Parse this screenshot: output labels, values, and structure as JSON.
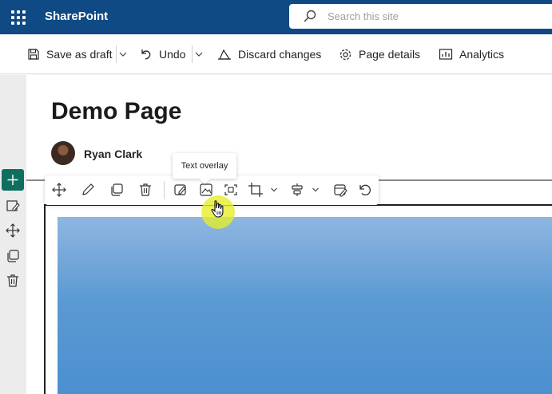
{
  "app": {
    "name": "SharePoint"
  },
  "search": {
    "placeholder": "Search this site"
  },
  "commands": {
    "save_as_draft": "Save as draft",
    "undo": "Undo",
    "discard_changes": "Discard changes",
    "page_details": "Page details",
    "analytics": "Analytics"
  },
  "page": {
    "title": "Demo Page",
    "author": "Ryan Clark"
  },
  "tooltip": {
    "text": "Text overlay"
  },
  "colors": {
    "suitebar": "#0f4a85",
    "accent_add": "#0e6e5f",
    "image_sky": "#5b9ad3",
    "click_highlight": "#e6ee28"
  },
  "icons": {
    "toolbar": [
      "move-icon",
      "edit-icon",
      "duplicate-icon",
      "delete-icon",
      "image-edit-icon",
      "text-overlay-icon",
      "crop-ratio-icon",
      "crop-icon",
      "align-icon",
      "edit-details-icon",
      "reset-icon"
    ],
    "rail": [
      "add-section-icon",
      "edit-section-icon",
      "move-section-icon",
      "duplicate-section-icon",
      "delete-section-icon"
    ]
  }
}
